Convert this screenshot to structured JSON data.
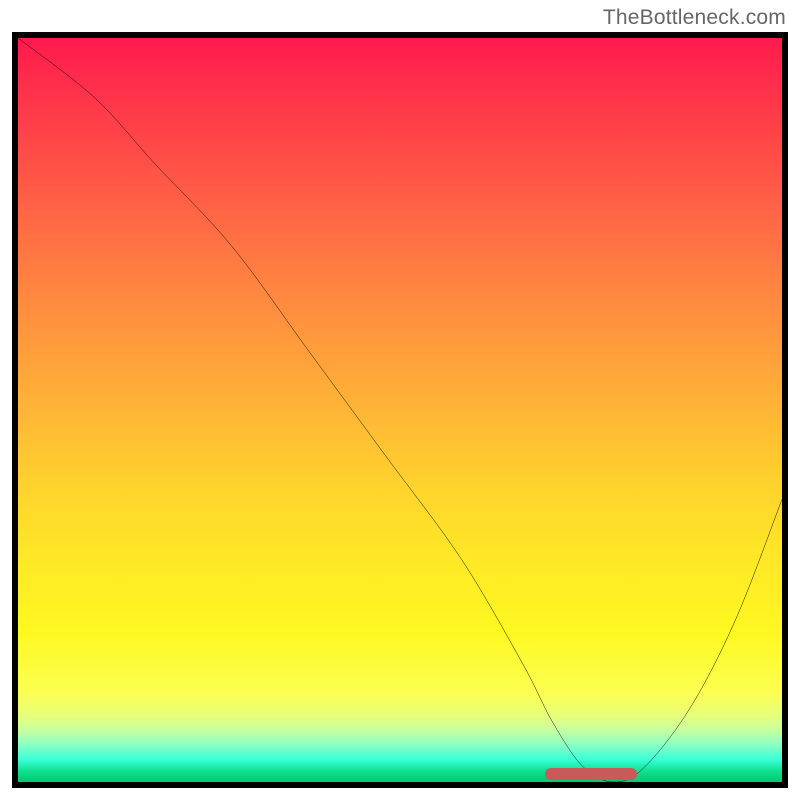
{
  "attribution": "TheBottleneck.com",
  "chart_data": {
    "type": "line",
    "title": "",
    "xlabel": "",
    "ylabel": "",
    "xlim": [
      0,
      100
    ],
    "ylim": [
      0,
      100
    ],
    "x": [
      0,
      10,
      18,
      28,
      38,
      48,
      58,
      66,
      70,
      74,
      78,
      82,
      88,
      94,
      100
    ],
    "values": [
      100,
      92,
      83,
      72,
      58,
      44,
      30,
      16,
      8,
      2,
      0,
      2,
      10,
      22,
      38
    ],
    "marker": {
      "start_x": 69,
      "end_x": 81,
      "y": 0
    },
    "gradient_stops": [
      {
        "pos": 0,
        "color": "#ff1a4d"
      },
      {
        "pos": 50,
        "color": "#ffd22d"
      },
      {
        "pos": 88,
        "color": "#fcff52"
      },
      {
        "pos": 100,
        "color": "#00c870"
      }
    ]
  }
}
